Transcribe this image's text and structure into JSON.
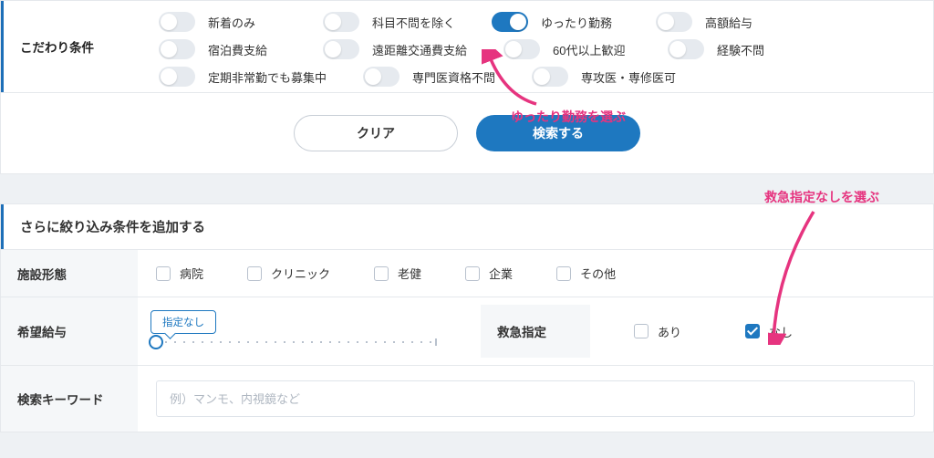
{
  "colors": {
    "accent": "#1e78c0",
    "annotation": "#e6347f"
  },
  "preferences": {
    "label": "こだわり条件",
    "items": [
      {
        "name": "new-only",
        "label": "新着のみ",
        "on": false
      },
      {
        "name": "exclude-dept",
        "label": "科目不問を除く",
        "on": false
      },
      {
        "name": "relaxed-work",
        "label": "ゆったり勤務",
        "on": true
      },
      {
        "name": "high-salary",
        "label": "高額給与",
        "on": false
      },
      {
        "name": "lodging",
        "label": "宿泊費支給",
        "on": false
      },
      {
        "name": "travel-cost",
        "label": "遠距離交通費支給",
        "on": false
      },
      {
        "name": "over60",
        "label": "60代以上歓迎",
        "on": false
      },
      {
        "name": "exp-any",
        "label": "経験不問",
        "on": false
      },
      {
        "name": "irregular-ok",
        "label": "定期非常勤でも募集中",
        "on": false
      },
      {
        "name": "spec-any",
        "label": "専門医資格不問",
        "on": false
      },
      {
        "name": "resident-ok",
        "label": "専攻医・専修医可",
        "on": false
      }
    ]
  },
  "buttons": {
    "clear": "クリア",
    "search": "検索する"
  },
  "refine": {
    "title": "さらに絞り込み条件を追加する",
    "facility": {
      "label": "施設形態",
      "options": [
        {
          "name": "hospital",
          "label": "病院",
          "checked": false
        },
        {
          "name": "clinic",
          "label": "クリニック",
          "checked": false
        },
        {
          "name": "rouken",
          "label": "老健",
          "checked": false
        },
        {
          "name": "company",
          "label": "企業",
          "checked": false
        },
        {
          "name": "other",
          "label": "その他",
          "checked": false
        }
      ]
    },
    "salary": {
      "label": "希望給与",
      "value_label": "指定なし"
    },
    "emergency": {
      "label": "救急指定",
      "options": [
        {
          "name": "yes",
          "label": "あり",
          "checked": false
        },
        {
          "name": "no",
          "label": "なし",
          "checked": true
        }
      ]
    },
    "keyword": {
      "label": "検索キーワード",
      "placeholder": "例）マンモ、内視鏡など"
    }
  },
  "annotations": {
    "a1": "ゆったり勤務を選ぶ",
    "a2": "救急指定なしを選ぶ"
  }
}
